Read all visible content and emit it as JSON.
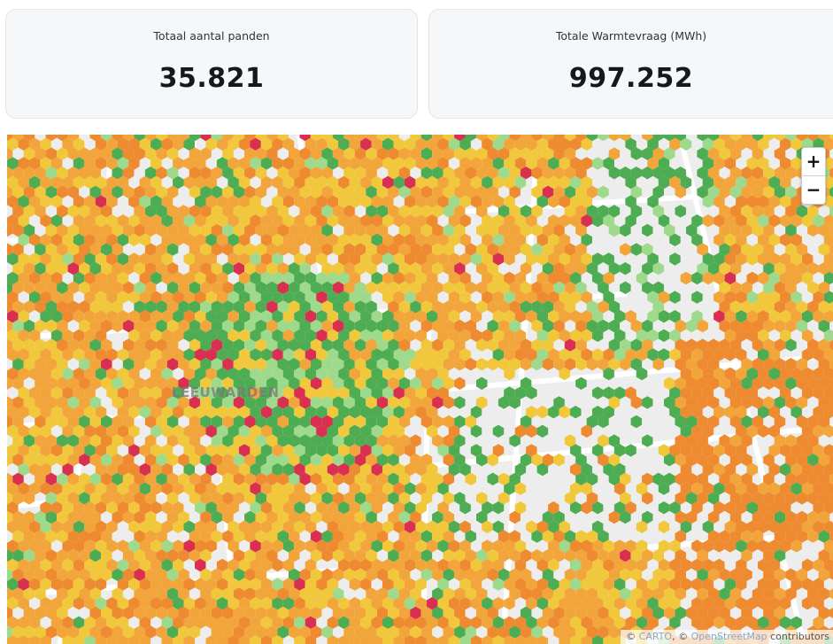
{
  "kpis": [
    {
      "label": "Totaal aantal panden",
      "value": "35.821"
    },
    {
      "label": "Totale Warmtevraag (MWh)",
      "value": "997.252"
    }
  ],
  "map": {
    "city_label": "LEEUWARDEN",
    "zoom_in_label": "+",
    "zoom_out_label": "−",
    "attribution": {
      "prefix": "© ",
      "carto": "CARTO",
      "sep": ", © ",
      "osm": "OpenStreetMap",
      "suffix": " contributors"
    },
    "colors": {
      "dark_orange": "#ee8a2f",
      "orange": "#f2a53a",
      "yellow": "#f1c83b",
      "light_green": "#9fd98b",
      "green": "#4eac52",
      "red": "#d93052",
      "background": "#ededed",
      "road": "#ffffff"
    }
  }
}
